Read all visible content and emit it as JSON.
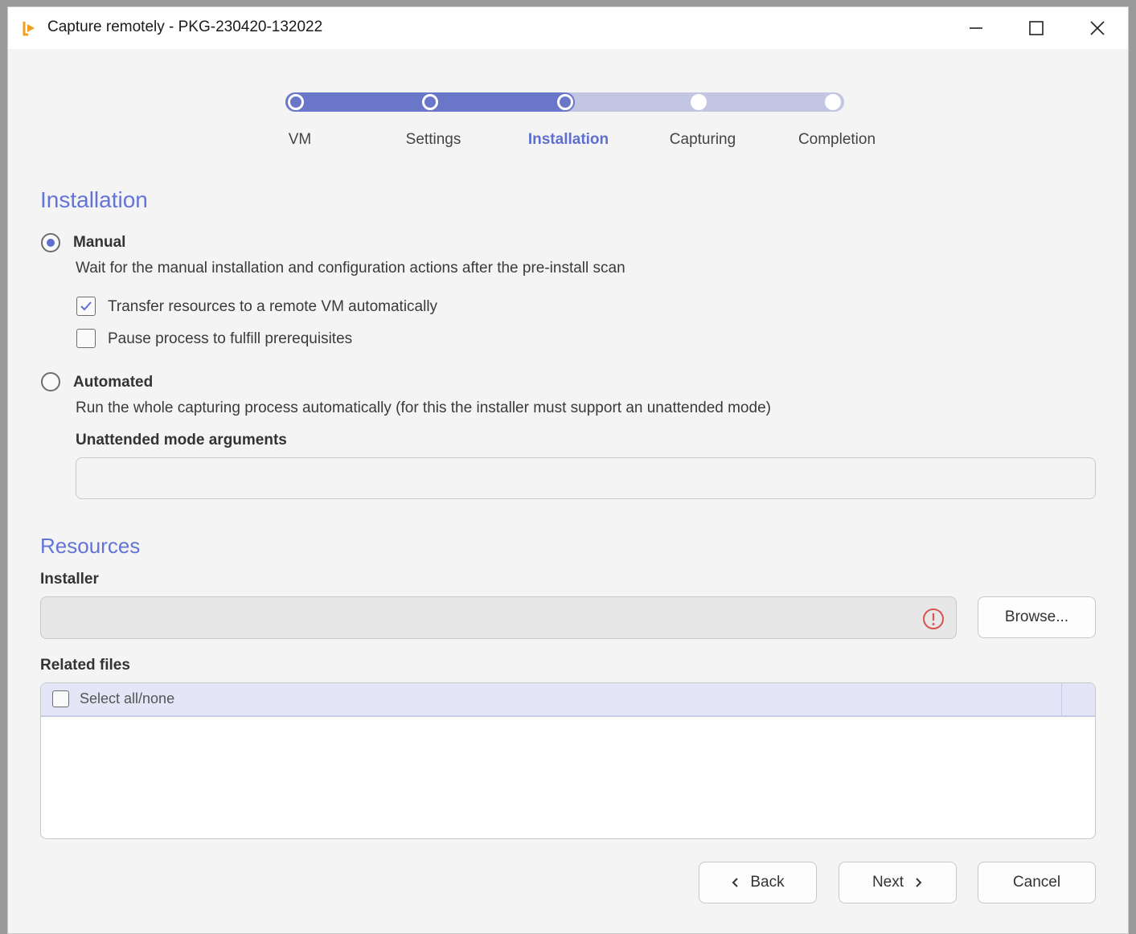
{
  "window": {
    "title": "Capture remotely - PKG-230420-132022",
    "controls": {
      "minimize": "minimize-icon",
      "maximize": "maximize-icon",
      "close": "close-icon"
    }
  },
  "stepper": {
    "steps": [
      {
        "label": "VM",
        "state": "done"
      },
      {
        "label": "Settings",
        "state": "done"
      },
      {
        "label": "Installation",
        "state": "current"
      },
      {
        "label": "Capturing",
        "state": "todo"
      },
      {
        "label": "Completion",
        "state": "todo"
      }
    ]
  },
  "installation": {
    "title": "Installation",
    "manual": {
      "label": "Manual",
      "selected": true,
      "description": "Wait for the manual installation and configuration actions after the pre-install scan",
      "options": [
        {
          "label": "Transfer resources to a remote VM automatically",
          "checked": true
        },
        {
          "label": "Pause process to fulfill prerequisites",
          "checked": false
        }
      ]
    },
    "automated": {
      "label": "Automated",
      "selected": false,
      "description": "Run the whole capturing process automatically (for this the installer must support an unattended mode)",
      "args_label": "Unattended mode arguments",
      "args_value": ""
    }
  },
  "resources": {
    "title": "Resources",
    "installer_label": "Installer",
    "installer_value": "",
    "browse_label": "Browse...",
    "related_files_label": "Related files",
    "select_all_label": "Select all/none",
    "files": []
  },
  "footer": {
    "back_label": "Back",
    "next_label": "Next",
    "cancel_label": "Cancel"
  },
  "colors": {
    "accent": "#6474d6",
    "progress_done": "#6a77c8",
    "progress_todo": "#c3c6e2",
    "app_icon": "#f0a020",
    "warning": "#d9534f"
  }
}
